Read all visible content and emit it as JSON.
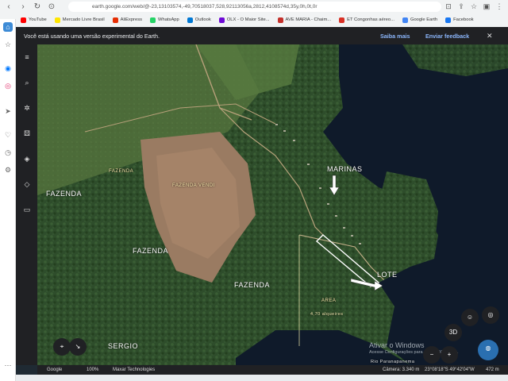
{
  "browser": {
    "url": "earth.google.com/web/@-23,13103574,-49,70518037,528,92113056a,2812,4108574d,35y,0h,0t,0r",
    "bookmarks": [
      {
        "label": "YouTube",
        "color": "#ff0000"
      },
      {
        "label": "Mercado Livre Brasil",
        "color": "#ffe600"
      },
      {
        "label": "AliExpress",
        "color": "#e62e04"
      },
      {
        "label": "WhatsApp",
        "color": "#25d366"
      },
      {
        "label": "Outlook",
        "color": "#0078d4"
      },
      {
        "label": "OLX - O Maior Site...",
        "color": "#6e0ad6"
      },
      {
        "label": "AVE MARIA - Chaim...",
        "color": "#c4302b"
      },
      {
        "label": "ET Congonhas aéreo...",
        "color": "#d93025"
      },
      {
        "label": "Google Earth",
        "color": "#4285f4"
      },
      {
        "label": "Facebook",
        "color": "#1877f2"
      }
    ]
  },
  "banner": {
    "message": "Você está usando uma versão experimental do Earth.",
    "learn_more": "Saiba mais",
    "feedback": "Enviar feedback"
  },
  "map_labels": {
    "marinas": "MARINAS",
    "fazenda_1": "FAZENDA",
    "fazenda_2": "FAZENDA",
    "fazenda_3": "FAZENDA",
    "fazenda_small": "FAZENDA",
    "fazenda_vendida": "FAZENDA VENDI",
    "sergio": "SERGIO",
    "lote": "LOTE",
    "area": "AREA",
    "alqueires": "4,70 alqueires",
    "river": "Rio Paranapanema"
  },
  "windows_activation": {
    "title": "Ativar o Windows",
    "subtitle": "Acesse Configurações para ativar o Windows."
  },
  "status_bar": {
    "google": "Google",
    "zoom": "100%",
    "imagery": "Maxar Technologies",
    "camera": "Câmera: 3.340 m",
    "coords": "23°08'18\"S 49°42'04\"W",
    "altitude": "472 m"
  },
  "controls": {
    "three_d": "3D"
  }
}
